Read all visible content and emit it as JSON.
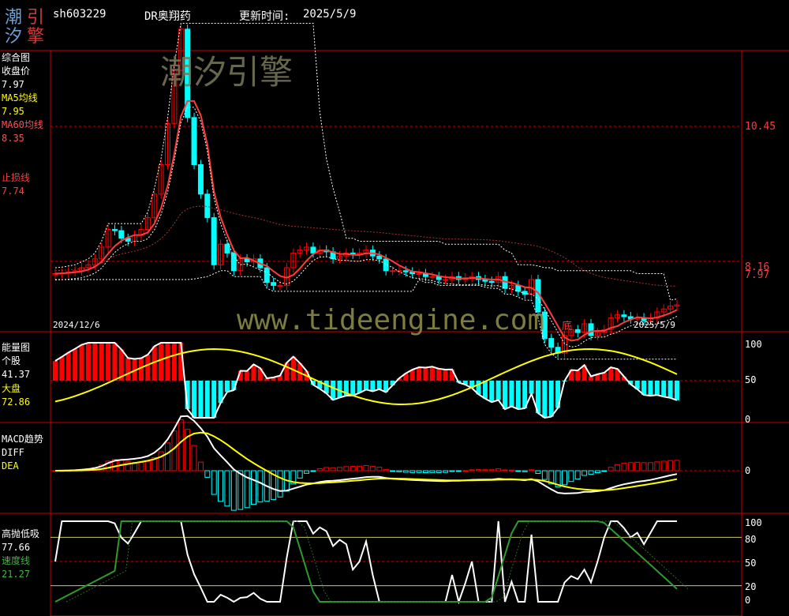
{
  "header": {
    "logo": "潮汐引擎",
    "code": "sh603229",
    "name": "DR奥翔药",
    "update_label": "更新时间:",
    "update_date": "2025/5/9"
  },
  "watermark": {
    "cn": "潮汐引擎",
    "url": "www.tideengine.com"
  },
  "colors": {
    "frame": "#cc0000",
    "up": "#ff0000",
    "down": "#00ffff",
    "ma5": "#ffff00",
    "ma60": "#ff3b3b",
    "stop": "#ff3b3b",
    "white": "#ffffff",
    "speed": "#2e9b2e"
  },
  "panel_main": {
    "title": "综合图",
    "close_label": "收盘价",
    "close_value": "7.97",
    "ma5_label": "MA5均线",
    "ma5_value": "7.95",
    "ma60_label": "MA60均线",
    "ma60_value": "8.35",
    "stop_label": "止损线",
    "stop_value": "7.74",
    "price_levels": [
      "10.45",
      "8.16",
      "7.97"
    ],
    "date_start": "2024/12/6",
    "date_end": "2025/5/9",
    "bottom_marker": "底"
  },
  "panel_energy": {
    "title": "能量图",
    "stock_label": "个股",
    "stock_value": "41.37",
    "market_label": "大盘",
    "market_value": "72.86",
    "axis": [
      "100",
      "50",
      "0"
    ]
  },
  "panel_macd": {
    "title": "MACD趋势",
    "diff_label": "DIFF",
    "dea_label": "DEA",
    "axis": [
      "0"
    ]
  },
  "panel_hl": {
    "title": "高抛低吸",
    "hl_value": "77.66",
    "speed_label": "速度线",
    "speed_value": "21.27",
    "axis": [
      "100",
      "80",
      "50",
      "20",
      "0"
    ]
  },
  "chart_data": {
    "type": "candlestick",
    "title": "sh603229 DR奥翔药",
    "x_range": [
      "2024/12/6",
      "2025/5/9"
    ],
    "price_axis_labels": [
      10.45,
      8.16,
      7.97
    ],
    "last": {
      "close": 7.97,
      "ma5": 7.95,
      "ma60": 8.35,
      "stop": 7.74
    },
    "energy_last": {
      "stock": 41.37,
      "market": 72.86
    },
    "hl_last": {
      "hl": 77.66,
      "speed": 21.27
    },
    "closes": [
      7.95,
      7.96,
      7.98,
      8.0,
      8.05,
      8.1,
      8.2,
      8.4,
      8.7,
      8.68,
      8.55,
      8.5,
      8.6,
      8.7,
      8.9,
      9.3,
      9.8,
      10.5,
      11.4,
      12.1,
      10.6,
      9.8,
      9.3,
      8.9,
      8.1,
      8.45,
      8.3,
      8.0,
      8.2,
      8.15,
      8.2,
      8.05,
      7.8,
      7.75,
      7.75,
      8.05,
      8.3,
      8.35,
      8.4,
      8.3,
      8.35,
      8.32,
      8.2,
      8.25,
      8.3,
      8.28,
      8.3,
      8.35,
      8.25,
      8.2,
      8.0,
      8.0,
      8.0,
      7.98,
      7.95,
      7.95,
      7.9,
      7.9,
      7.85,
      7.85,
      7.9,
      7.85,
      7.88,
      7.9,
      7.85,
      7.82,
      7.8,
      7.9,
      7.7,
      7.75,
      7.65,
      7.6,
      7.85,
      7.3,
      6.85,
      6.7,
      6.6,
      6.9,
      7.0,
      6.95,
      7.1,
      6.9,
      6.95,
      7.0,
      7.2,
      7.25,
      7.22,
      7.18,
      7.2,
      7.15,
      7.2,
      7.3,
      7.35,
      7.4,
      7.42
    ]
  }
}
